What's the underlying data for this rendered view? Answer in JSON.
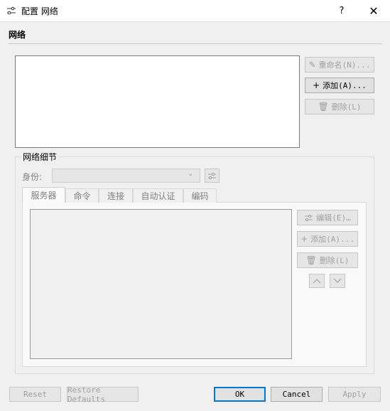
{
  "window": {
    "title": "配置 网络",
    "icon": "sliders-icon",
    "help_label": "?",
    "close_label": "✕"
  },
  "section": {
    "title": "网络"
  },
  "network_buttons": {
    "rename": "重命名(N)...",
    "add": "添加(A)...",
    "delete": "删除(L)"
  },
  "details": {
    "title": "网络细节",
    "identity_label": "身份:",
    "identity_value": "",
    "tabs": [
      {
        "label": "服务器"
      },
      {
        "label": "命令"
      },
      {
        "label": "连接"
      },
      {
        "label": "自动认证"
      },
      {
        "label": "编码"
      }
    ],
    "edit": "编辑(E)…",
    "add": "添加(A)...",
    "delete": "删除(L)"
  },
  "footer": {
    "reset": "Reset",
    "restore": "Restore Defaults",
    "ok": "OK",
    "cancel": "Cancel",
    "apply": "Apply"
  },
  "colors": {
    "window_bg": "#f0f0f0",
    "focus_border": "#0078d7",
    "disabled_text": "#a0a0a0"
  }
}
